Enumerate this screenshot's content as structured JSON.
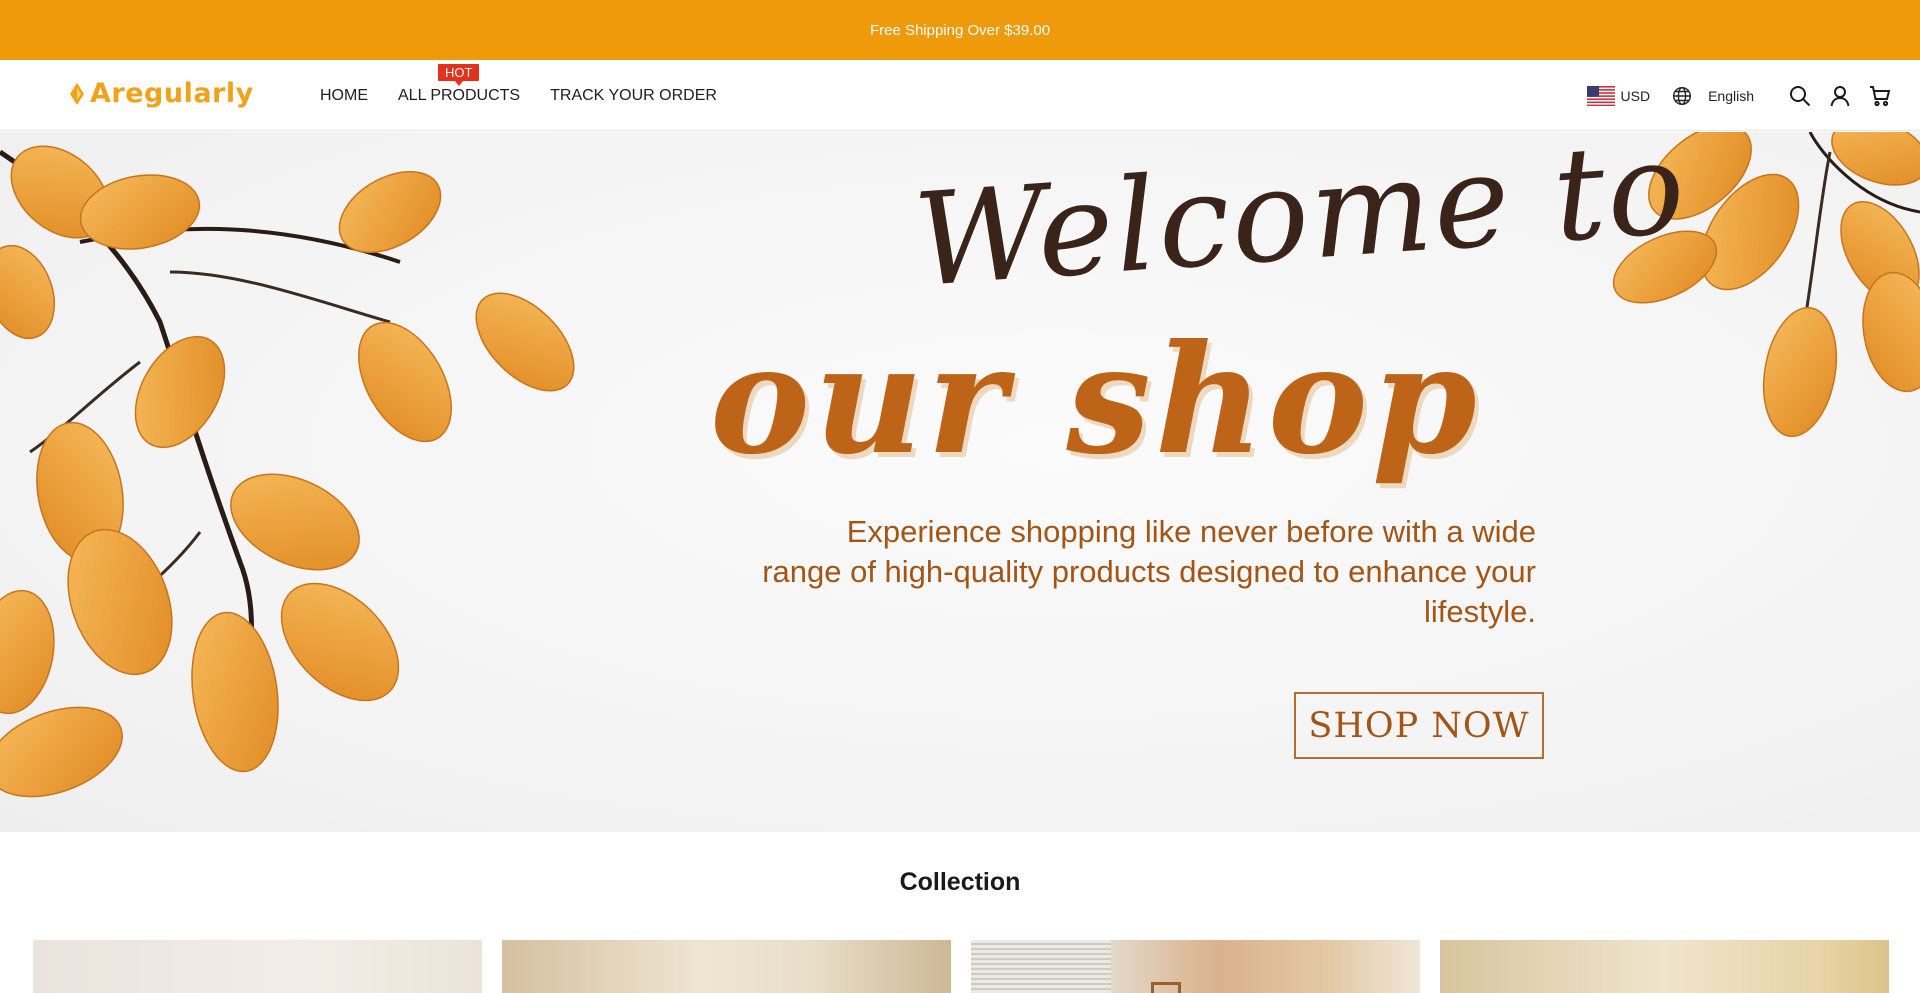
{
  "announcement": {
    "text": "Free Shipping Over $39.00"
  },
  "header": {
    "logo_text": "Aregularly",
    "brand_color": "#f0a21a",
    "nav": [
      {
        "label": "HOME"
      },
      {
        "label": "ALL PRODUCTS",
        "badge": "HOT"
      },
      {
        "label": "TRACK YOUR ORDER"
      }
    ],
    "currency": {
      "label": "USD",
      "icon": "us-flag-icon"
    },
    "language": {
      "label": "English",
      "icon": "globe-icon"
    },
    "icons": [
      "search-icon",
      "account-icon",
      "cart-icon"
    ]
  },
  "hero": {
    "title_script": "Welcome to",
    "title_bold": "our shop",
    "description": "Experience shopping like never before with a wide range of high-quality products designed to enhance your lifestyle.",
    "cta_label": "SHOP NOW",
    "colors": {
      "script": "#3a2318",
      "accent": "#bd6418",
      "leaves": "#f0a545"
    }
  },
  "collection": {
    "title": "Collection",
    "cards": [
      {
        "name": "collection-card-1"
      },
      {
        "name": "collection-card-2"
      },
      {
        "name": "collection-card-3"
      },
      {
        "name": "collection-card-4"
      }
    ]
  },
  "colors": {
    "announcement_bg": "#ee9a0b",
    "hot_badge": "#e2311d"
  }
}
